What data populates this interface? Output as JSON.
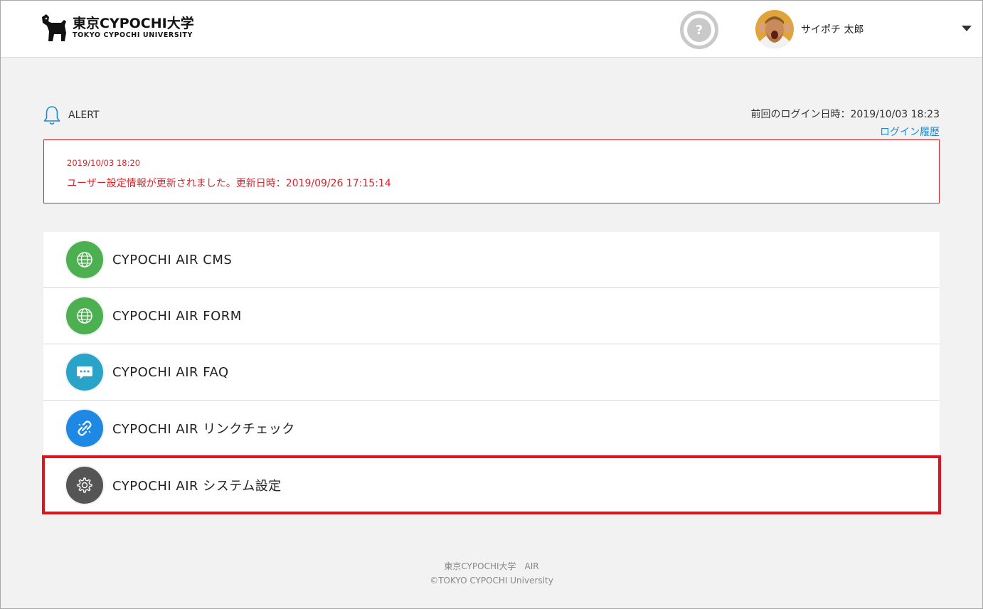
{
  "header": {
    "logo_main": "東京CYPOCHI大学",
    "logo_sub": "TOKYO CYPOCHI UNIVERSITY",
    "help_symbol": "?",
    "user_name": "サイポチ 太郎"
  },
  "alert": {
    "label": "ALERT",
    "last_login": "前回のログイン日時：2019/10/03 18:23",
    "login_history_link": "ログイン履歴",
    "date": "2019/10/03 18:20",
    "message": "ユーザー設定情報が更新されました。更新日時：2019/09/26 17:15:14"
  },
  "apps": [
    {
      "label": "CYPOCHI AIR CMS",
      "icon": "globe-icon",
      "color": "#4caf50"
    },
    {
      "label": "CYPOCHI AIR FORM",
      "icon": "globe-icon",
      "color": "#4caf50"
    },
    {
      "label": "CYPOCHI AIR FAQ",
      "icon": "chat-bubble-icon",
      "color": "#29a3c7"
    },
    {
      "label": "CYPOCHI AIR リンクチェック",
      "icon": "broken-link-icon",
      "color": "#1e88e5"
    },
    {
      "label": "CYPOCHI AIR システム設定",
      "icon": "gear-icon",
      "color": "#555555"
    }
  ],
  "footer": {
    "line1": "東京CYPOCHI大学　AIR",
    "line2": "©TOKYO CYPOCHI University"
  },
  "colors": {
    "alert_red": "#d9232a",
    "link_blue": "#1a8ad4",
    "highlight_red": "#e0141c"
  }
}
